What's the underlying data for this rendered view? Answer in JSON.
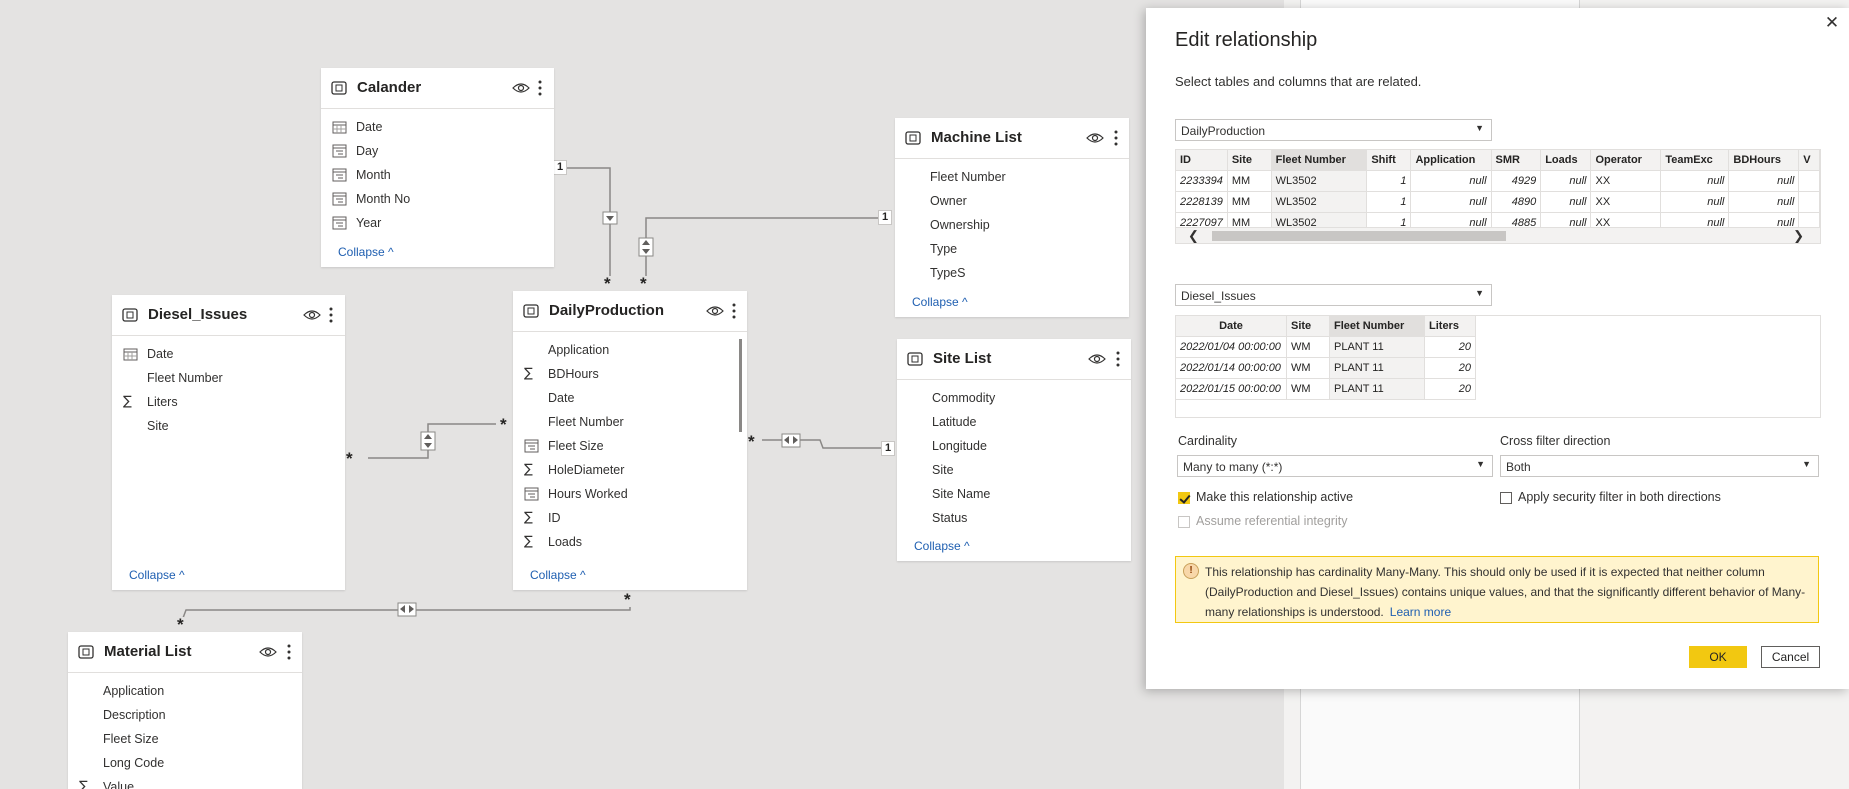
{
  "tables": {
    "calander": {
      "title": "Calander",
      "fields": [
        {
          "icon": "calendar-icon",
          "label": "Date"
        },
        {
          "icon": "hierarchy-icon",
          "label": "Day"
        },
        {
          "icon": "hierarchy-icon",
          "label": "Month"
        },
        {
          "icon": "hierarchy-icon",
          "label": "Month No"
        },
        {
          "icon": "hierarchy-icon",
          "label": "Year"
        }
      ],
      "collapse": "Collapse ^"
    },
    "machine_list": {
      "title": "Machine List",
      "fields": [
        {
          "icon": "",
          "label": "Fleet Number"
        },
        {
          "icon": "",
          "label": "Owner"
        },
        {
          "icon": "",
          "label": "Ownership"
        },
        {
          "icon": "",
          "label": "Type"
        },
        {
          "icon": "",
          "label": "TypeS"
        }
      ],
      "collapse": "Collapse ^"
    },
    "diesel_issues": {
      "title": "Diesel_Issues",
      "fields": [
        {
          "icon": "calendar-icon",
          "label": "Date"
        },
        {
          "icon": "",
          "label": "Fleet Number"
        },
        {
          "icon": "sigma-icon",
          "label": "Liters"
        },
        {
          "icon": "",
          "label": "Site"
        }
      ],
      "collapse": "Collapse ^"
    },
    "daily_production": {
      "title": "DailyProduction",
      "fields": [
        {
          "icon": "",
          "label": "Application"
        },
        {
          "icon": "sigma-icon",
          "label": "BDHours"
        },
        {
          "icon": "",
          "label": "Date"
        },
        {
          "icon": "",
          "label": "Fleet Number"
        },
        {
          "icon": "hierarchy-icon",
          "label": "Fleet Size"
        },
        {
          "icon": "sigma-icon",
          "label": "HoleDiameter"
        },
        {
          "icon": "hierarchy-icon",
          "label": "Hours Worked"
        },
        {
          "icon": "sigma-icon",
          "label": "ID"
        },
        {
          "icon": "sigma-icon",
          "label": "Loads"
        }
      ],
      "collapse": "Collapse ^"
    },
    "site_list": {
      "title": "Site List",
      "fields": [
        {
          "icon": "",
          "label": "Commodity"
        },
        {
          "icon": "",
          "label": "Latitude"
        },
        {
          "icon": "",
          "label": "Longitude"
        },
        {
          "icon": "",
          "label": "Site"
        },
        {
          "icon": "",
          "label": "Site Name"
        },
        {
          "icon": "",
          "label": "Status"
        }
      ],
      "collapse": "Collapse ^"
    },
    "material_list": {
      "title": "Material List",
      "fields": [
        {
          "icon": "",
          "label": "Application"
        },
        {
          "icon": "",
          "label": "Description"
        },
        {
          "icon": "",
          "label": "Fleet Size"
        },
        {
          "icon": "",
          "label": "Long Code"
        },
        {
          "icon": "sigma-icon",
          "label": "Value"
        }
      ]
    }
  },
  "connectors": {
    "one": "1",
    "many": "*"
  },
  "dialog": {
    "title": "Edit relationship",
    "subtitle": "Select tables and columns that are related.",
    "table1": {
      "selected": "DailyProduction",
      "columns": [
        "ID",
        "Site",
        "Fleet Number",
        "Shift",
        "Application",
        "SMR",
        "Loads",
        "Operator",
        "TeamExc",
        "BDHours",
        "V"
      ],
      "rows": [
        [
          "2233394",
          "MM",
          "WL3502",
          "1",
          "null",
          "4929",
          "null",
          "XX",
          "null",
          "null",
          ""
        ],
        [
          "2228139",
          "MM",
          "WL3502",
          "1",
          "null",
          "4890",
          "null",
          "XX",
          "null",
          "null",
          ""
        ],
        [
          "2227097",
          "MM",
          "WL3502",
          "1",
          "null",
          "4885",
          "null",
          "XX",
          "null",
          "null",
          ""
        ]
      ]
    },
    "table2": {
      "selected": "Diesel_Issues",
      "columns": [
        "Date",
        "Site",
        "Fleet Number",
        "Liters"
      ],
      "rows": [
        [
          "2022/01/04 00:00:00",
          "WM",
          "PLANT 11",
          "20"
        ],
        [
          "2022/01/14 00:00:00",
          "WM",
          "PLANT 11",
          "20"
        ],
        [
          "2022/01/15 00:00:00",
          "WM",
          "PLANT 11",
          "20"
        ]
      ]
    },
    "cardinality_label": "Cardinality",
    "cardinality_value": "Many to many (*:*)",
    "crossfilter_label": "Cross filter direction",
    "crossfilter_value": "Both",
    "active_label": "Make this relationship active",
    "active_checked": true,
    "security_label": "Apply security filter in both directions",
    "integrity_label": "Assume referential integrity",
    "warning_text": "This relationship has cardinality Many-Many. This should only be used if it is expected that neither column (DailyProduction and Diesel_Issues) contains unique values, and that the significantly different behavior of Many-many relationships is understood.",
    "warning_link": "Learn more",
    "ok_label": "OK",
    "cancel_label": "Cancel"
  }
}
